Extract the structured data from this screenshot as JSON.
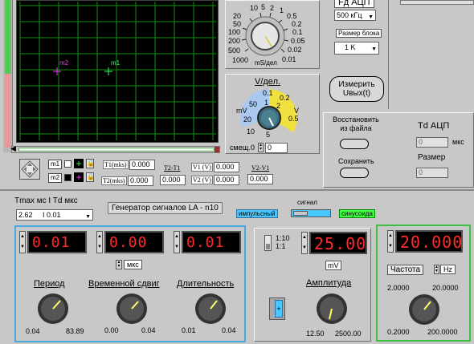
{
  "scope": {
    "markers": [
      {
        "label": "m2",
        "color": "#ff33ff"
      },
      {
        "label": "m1",
        "color": "#33ff66"
      }
    ],
    "time_scale": {
      "ticks": [
        "10",
        "5",
        "2",
        "1",
        "0.5",
        "0.2",
        "0.1",
        "0.05",
        "0.02",
        "0.01"
      ],
      "left_ticks": [
        "20",
        "50",
        "100",
        "200",
        "500",
        "1000"
      ],
      "unit": "mS/дел"
    },
    "volt_title": "V/дел.",
    "volt_ticks": [
      "0.1",
      "0.2",
      "1",
      "2",
      "50",
      "0.5",
      "20",
      "10",
      "5"
    ],
    "volt_mv": "mV",
    "volt_v": "V",
    "offset_label": "смещ.",
    "offset_value": "0",
    "offset_value2": "0"
  },
  "markers_panel": {
    "m1": "m1",
    "m2": "m2",
    "t1_label": "T1(mks)",
    "t1_value": "0.000",
    "t2_label": "T2(mks)",
    "t2_value": "0.000",
    "t2t1_label": "T2-T1",
    "t2t1_value": "0.000",
    "v1_label": "V1 (V)",
    "v1_value": "0.000",
    "v2_label": "V2 (V)",
    "v2_value": "0.000",
    "v2v1_label": "V2-V1",
    "v2v1_value": "0.000"
  },
  "adc": {
    "fd_label": "Fд АЦП",
    "fd_value": "500 кГц",
    "block_label": "Размер блока",
    "block_value": "1 K",
    "measure_label_1": "Измерить",
    "measure_label_2": "Uвых(t)"
  },
  "file": {
    "restore_label_1": "Восстановить",
    "restore_label_2": "из файла",
    "save_label": "Сохранить",
    "td_label": "Td АЦП",
    "td_value": "0",
    "td_unit": "мкс",
    "size_label": "Размер",
    "size_value": "0"
  },
  "generator": {
    "tmax_label": "Tmax мс I Td мкс",
    "tmax_value": "2.62",
    "td_value": "I  0.01",
    "title": "Генератор сигналов LA - n10",
    "signal_label": "сигнал",
    "mode_impulse": "импульсный",
    "mode_sine": "синусоида",
    "displays": [
      "0.01",
      "0.00",
      "0.01"
    ],
    "unit": "мкс",
    "period": {
      "label": "Период",
      "min": "0.04",
      "max": "83.89"
    },
    "shift": {
      "label": "Временной сдвиг",
      "min": "0.00",
      "max": "0.04"
    },
    "duration": {
      "label": "Длительность",
      "min": "0.01",
      "max": "0.04"
    }
  },
  "amplitude": {
    "ratio_1": "1:10",
    "ratio_2": "1:1",
    "value": "25.00",
    "unit": "mV",
    "label": "Амплитуда",
    "min": "12.50",
    "max": "2500.00",
    "toggle_text": "+"
  },
  "frequency": {
    "value": "20.0000",
    "label": "Частота",
    "unit": "Hz",
    "range_min_top": "2.0000",
    "range_max_top": "20.0000",
    "min": "0.2000",
    "max": "200.0000"
  }
}
